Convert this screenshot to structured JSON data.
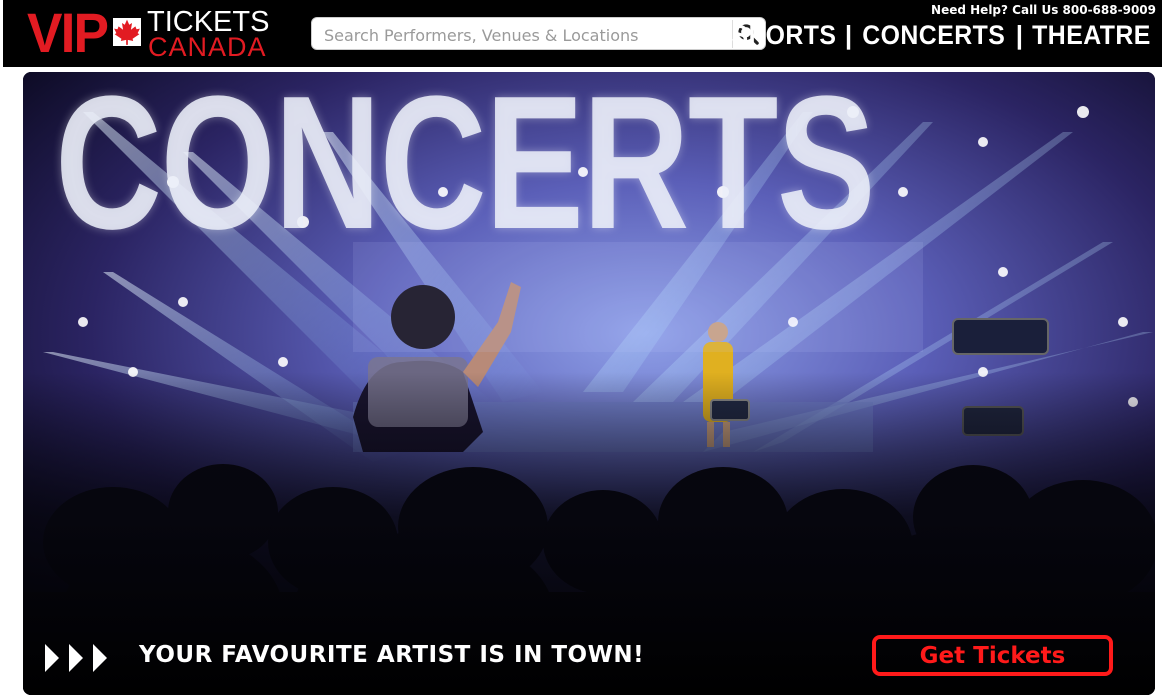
{
  "header": {
    "logo": {
      "vip": "VIP",
      "tickets": "TICKETS",
      "canada": "CANADA"
    },
    "search": {
      "placeholder": "Search Performers, Venues & Locations",
      "value": "",
      "icon": "search-icon"
    },
    "help_text": "Need Help? Call Us 800-688-9009",
    "nav": [
      {
        "label": "SPORTS"
      },
      {
        "label": "CONCERTS"
      },
      {
        "label": "THEATRE"
      }
    ],
    "nav_separator": "|"
  },
  "banner": {
    "headline": "CONCERTS",
    "tagline": "YOUR FAVOURITE ARTIST IS IN TOWN!",
    "cta_label": "Get Tickets",
    "arrow_icon": "triple-play-arrows-icon"
  },
  "colors": {
    "brand_red": "#e21b22",
    "header_bg": "#000000",
    "cta_red": "#ff1a1a"
  }
}
